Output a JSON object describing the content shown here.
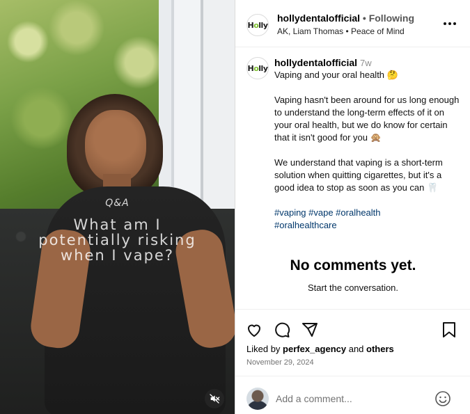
{
  "media": {
    "overlay_small": "Q&A",
    "overlay_lines": [
      "What am I",
      "potentially risking",
      "when I vape?"
    ],
    "mute_icon": "speaker-muted-icon"
  },
  "header": {
    "logo_text_h": "H",
    "logo_text_o": "o",
    "logo_text_rest": "lly",
    "username": "hollydentalofficial",
    "separator": " • ",
    "follow_status": "Following",
    "subline": "AK, Liam Thomas • Peace of Mind",
    "more_icon": "more-options-icon"
  },
  "caption": {
    "username": "hollydentalofficial",
    "age": "7w",
    "title": "Vaping and your oral health 🤔",
    "para1": "Vaping hasn't been around for us long enough to understand the long-term effects of it on your oral health, but we do know for certain that it isn't good for you 🙊",
    "para2": "We understand that vaping is a short-term solution when quitting cigarettes, but it's a good idea to stop as soon as you can 🦷",
    "hashtags_line1": "#vaping #vape #oralhealth",
    "hashtags_line2": "#oralhealthcare"
  },
  "comments": {
    "empty_title": "No comments yet.",
    "empty_subtitle": "Start the conversation."
  },
  "actions": {
    "like_icon": "heart-icon",
    "comment_icon": "comment-icon",
    "share_icon": "share-icon",
    "save_icon": "bookmark-icon",
    "liked_prefix": "Liked by ",
    "liked_user": "perfex_agency",
    "liked_and": " and ",
    "liked_others": "others",
    "date": "November 29, 2024"
  },
  "comment_input": {
    "placeholder": "Add a comment...",
    "emoji_icon": "emoji-icon"
  },
  "colors": {
    "hashtag": "#00376b",
    "muted_text": "#737373",
    "brand_green": "#7cbf2d"
  }
}
